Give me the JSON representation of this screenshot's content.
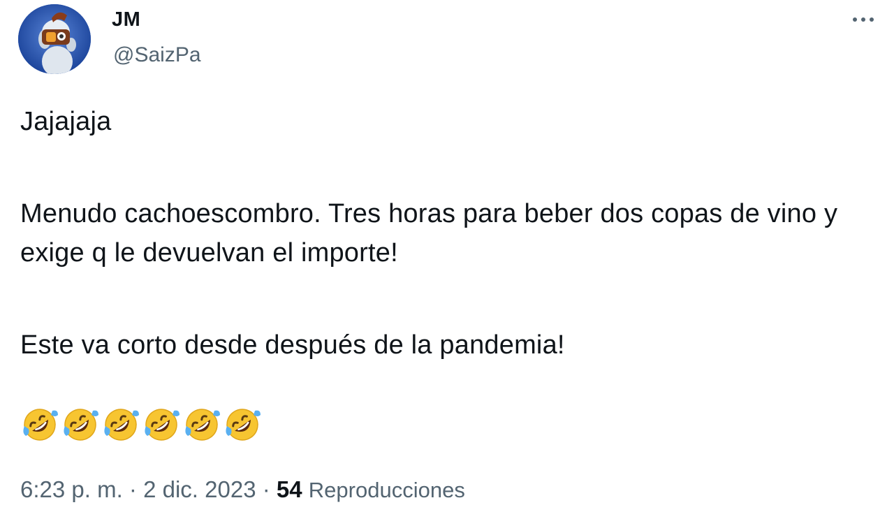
{
  "author": {
    "display_name": "JM",
    "handle": "@SaizPa"
  },
  "menu": {
    "icon": "more-horizontal-icon"
  },
  "tweet": {
    "line1": "Jajajaja",
    "line2": "Menudo cachoescombro. Tres horas para beber dos copas de vino y exige q le devuelvan el importe!",
    "line3": "Este va corto desde después de la pandemia!",
    "emojis": [
      "rolling-on-the-floor-laughing",
      "rolling-on-the-floor-laughing",
      "rolling-on-the-floor-laughing",
      "rolling-on-the-floor-laughing",
      "rolling-on-the-floor-laughing",
      "rolling-on-the-floor-laughing"
    ]
  },
  "meta": {
    "time": "6:23 p. m.",
    "separator": "·",
    "date": "2 dic. 2023",
    "views_count": "54",
    "views_label": "Reproducciones"
  },
  "colors": {
    "text": "#0f1419",
    "secondary": "#536471",
    "avatar_bg": "#1c4fb0"
  }
}
